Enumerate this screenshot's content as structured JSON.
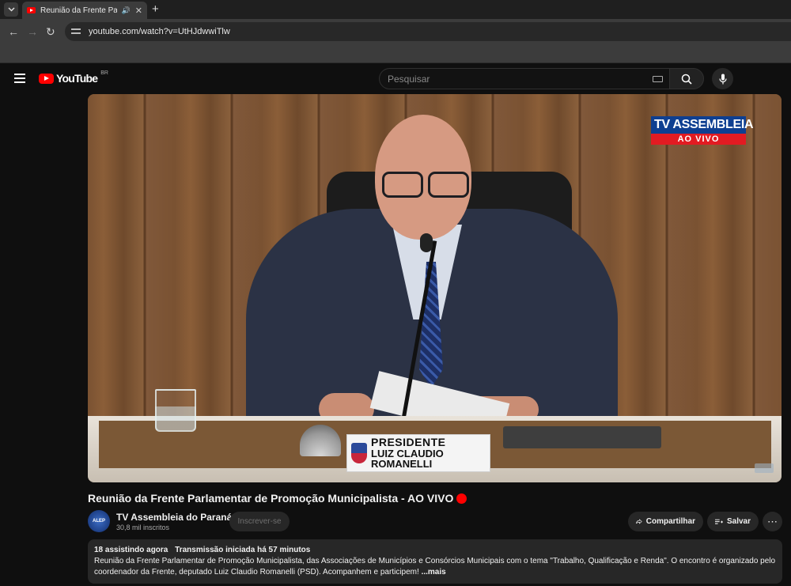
{
  "browser": {
    "tab_title": "Reunião da Frente Parlamen",
    "url": "youtube.com/watch?v=UtHJdwwiTlw",
    "new_tab_label": "+",
    "close_label": "✕",
    "audio_icon": "speaker-icon"
  },
  "youtube": {
    "logo_text": "YouTube",
    "region": "BR",
    "search_placeholder": "Pesquisar"
  },
  "video": {
    "overlay_channel": "TV ASSEMBLEIA",
    "overlay_live": "AO VIVO",
    "nameplate_line1": "PRESIDENTE",
    "nameplate_line2": "LUIZ CLAUDIO ROMANELLI"
  },
  "meta": {
    "title": "Reunião da Frente Parlamentar de Promoção Municipalista - AO VIVO",
    "channel_name": "TV Assembleia do Paraná",
    "subscribers": "30,8 mil inscritos",
    "subscribe_label": "Inscrever-se",
    "share_label": "Compartilhar",
    "save_label": "Salvar",
    "more_label": "⋯"
  },
  "description": {
    "watching": "18 assistindo agora",
    "started": "Transmissão iniciada há 57 minutos",
    "text": "Reunião da Frente Parlamentar de Promoção Municipalista, das Associações de Municípios e Consórcios Municipais com o tema \"Trabalho, Qualificação e Renda\". O encontro é organizado pelo coordenador da Frente, deputado Luiz Claudio Romanelli (PSD). Acompanhem e participem!",
    "more": "...mais"
  },
  "colors": {
    "accent_red": "#ff0000",
    "tv_blue": "#0e3f91",
    "tv_red": "#e21b22"
  }
}
